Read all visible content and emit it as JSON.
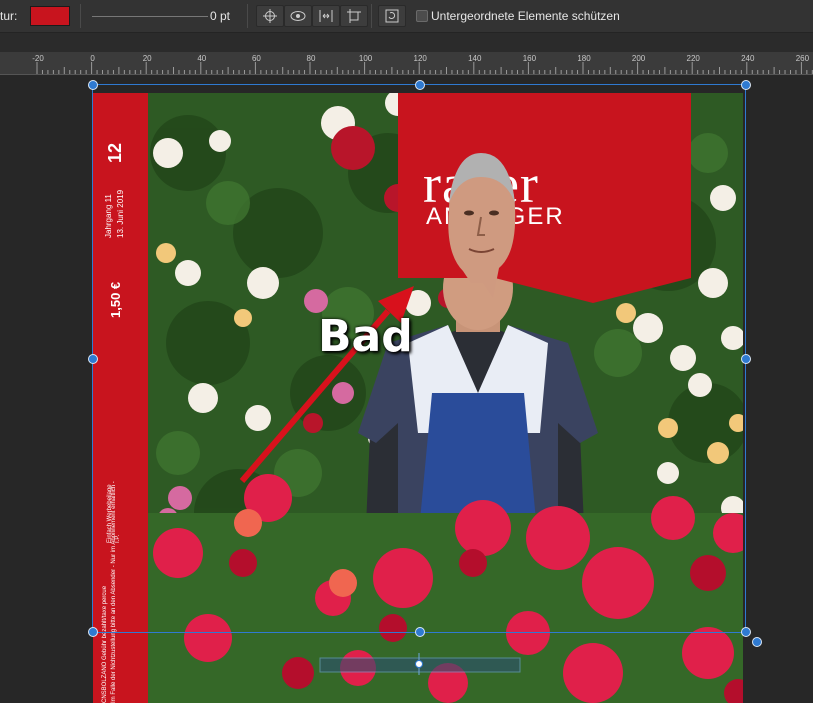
{
  "toolbar": {
    "stroke_label": "tur:",
    "stroke_color": "#c8141e",
    "stroke_width": "0 pt",
    "protect_label": "Untergeordnete Elemente schützen"
  },
  "ruler": {
    "ticks": [
      "-20",
      "0",
      "20",
      "40",
      "60",
      "80",
      "100",
      "120",
      "140",
      "160",
      "180",
      "200",
      "220",
      "240",
      "260"
    ]
  },
  "cover": {
    "issue_number": "12",
    "year_label": "Jahrgang 11",
    "date": "13. Juni 2019",
    "price": "1,50 €",
    "legal1": "Einfach Werbebeilage",
    "legal2": "I.P.",
    "postal1": "CNSBOLZANO Gebühr bezahlt/taxe percue",
    "postal2": "Im Falle der Nichtzustellung bitte an den Absender - Nur im Abonnement erhältlich -",
    "masthead_line1": "raner",
    "masthead_line2": "ANZEIGER",
    "annotation": "Bad",
    "brand_color": "#c8141e"
  }
}
